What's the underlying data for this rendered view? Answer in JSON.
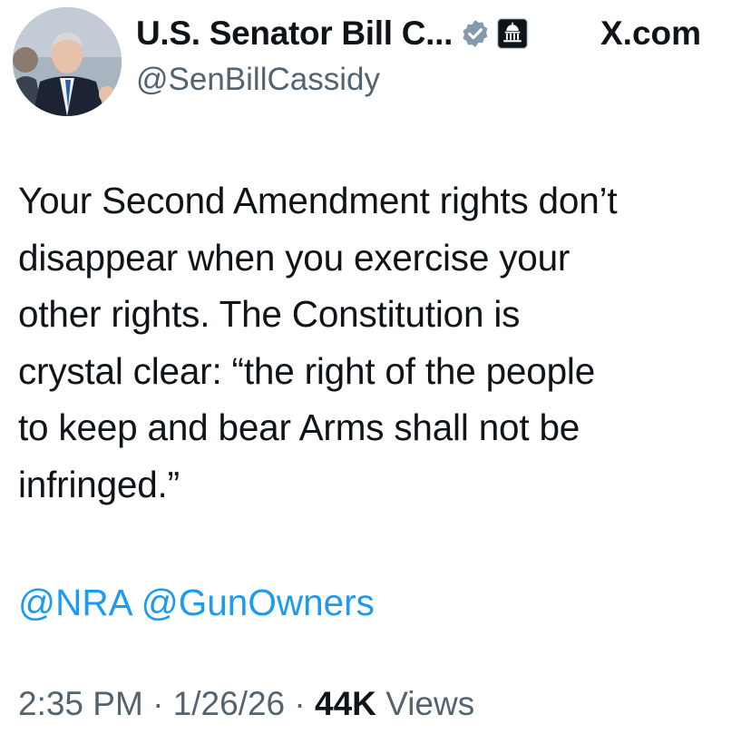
{
  "header": {
    "display_name": "U.S. Senator Bill C...",
    "handle": "@SenBillCassidy",
    "site_label": "X.com",
    "verified_color": "#829aab",
    "avatar_icon": "profile-photo",
    "affiliation_icon": "capitol-building-icon"
  },
  "tweet": {
    "lines": [
      "Your Second Amendment rights don’t",
      "disappear when you exercise your",
      "other rights. The Constitution is",
      "crystal clear: “the right of the people",
      "to keep and bear Arms shall not be",
      "infringed.”"
    ],
    "mentions": [
      "@NRA",
      "@GunOwners"
    ]
  },
  "meta": {
    "time": "2:35 PM",
    "separator": "·",
    "date": "1/26/26",
    "views_count": "44K",
    "views_label": "Views"
  },
  "colors": {
    "text": "#0f1419",
    "secondary": "#536471",
    "link": "#1d9bf0"
  }
}
